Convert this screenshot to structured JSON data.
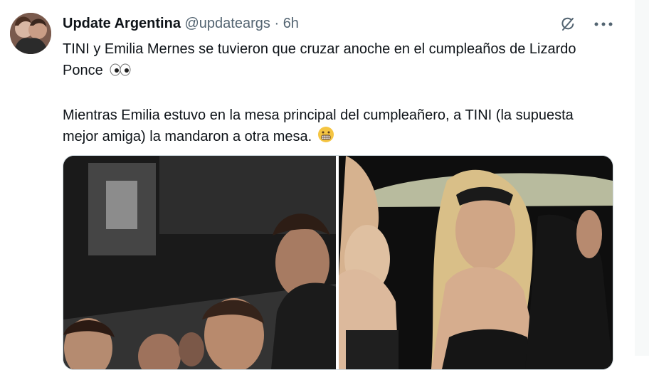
{
  "tweet": {
    "author_name": "Update Argentina",
    "author_handle": "@updateargs",
    "separator": "·",
    "time": "6h",
    "text_line1": "TINI y Emilia Mernes se tuvieron que cruzar anoche en el cumpleaños de Lizardo Ponce",
    "text_paragraph2": "Mientras Emilia estuvo en la mesa principal del cumpleañero, a TINI (la supuesta mejor amiga) la mandaron a otra mesa.",
    "icons": {
      "grok": "grok-icon",
      "more": "more-options-icon",
      "eyes": "eyes-emoji-icon",
      "grimace": "grimacing-emoji-icon"
    }
  },
  "colors": {
    "text": "#0f1419",
    "secondary_text": "#536471",
    "border": "#cfd9de"
  }
}
